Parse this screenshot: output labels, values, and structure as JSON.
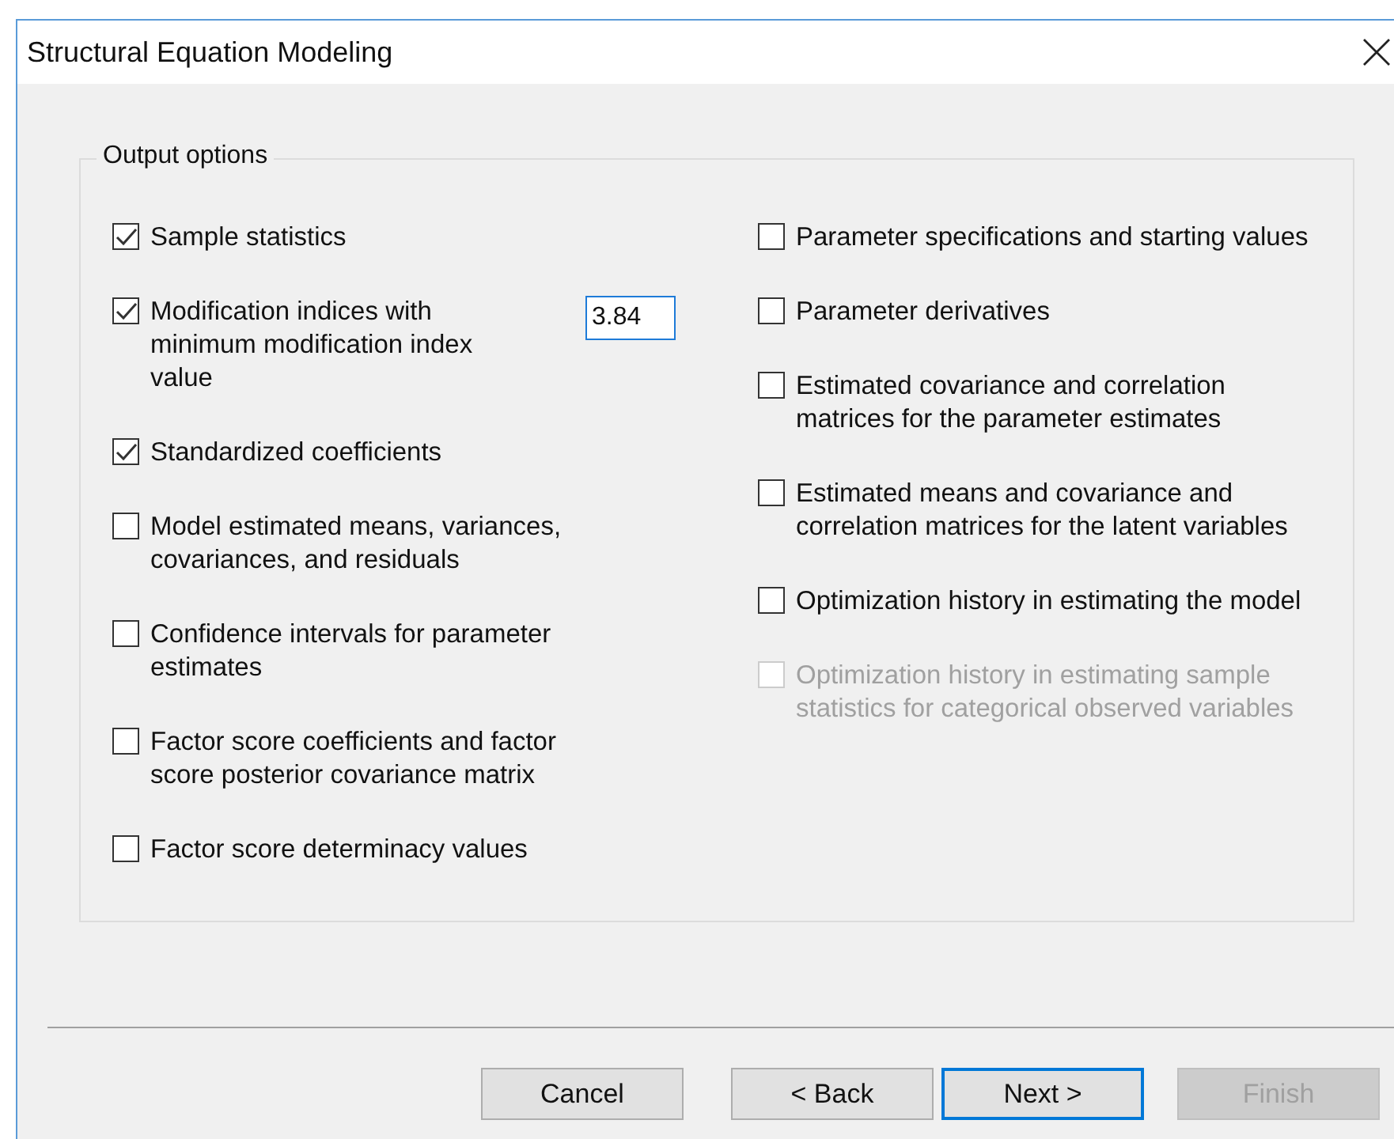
{
  "window": {
    "title": "Structural Equation Modeling"
  },
  "group": {
    "title": "Output options",
    "left": [
      {
        "label": "Sample statistics",
        "checked": true,
        "disabled": false
      },
      {
        "label": "Modification indices with minimum modification index value",
        "checked": true,
        "disabled": false,
        "value": "3.84"
      },
      {
        "label": "Standardized coefficients",
        "checked": true,
        "disabled": false
      },
      {
        "label": "Model estimated means, variances, covariances, and residuals",
        "checked": false,
        "disabled": false
      },
      {
        "label": "Confidence intervals for parameter estimates",
        "checked": false,
        "disabled": false
      },
      {
        "label": "Factor score coefficients and factor score posterior covariance matrix",
        "checked": false,
        "disabled": false
      },
      {
        "label": "Factor score determinacy values",
        "checked": false,
        "disabled": false
      }
    ],
    "right": [
      {
        "label": "Parameter specifications and starting values",
        "checked": false,
        "disabled": false
      },
      {
        "label": "Parameter derivatives",
        "checked": false,
        "disabled": false
      },
      {
        "label": "Estimated covariance and correlation matrices for the parameter estimates",
        "checked": false,
        "disabled": false
      },
      {
        "label": "Estimated means and covariance and correlation matrices for the latent variables",
        "checked": false,
        "disabled": false
      },
      {
        "label": "Optimization history in estimating the model",
        "checked": false,
        "disabled": false
      },
      {
        "label": "Optimization history in estimating sample statistics for categorical observed variables",
        "checked": false,
        "disabled": true
      }
    ]
  },
  "buttons": [
    {
      "label": "Cancel",
      "default": false,
      "disabled": false
    },
    {
      "label": "< Back",
      "default": false,
      "disabled": false
    },
    {
      "label": "Next >",
      "default": true,
      "disabled": false
    },
    {
      "label": "Finish",
      "default": false,
      "disabled": true
    }
  ]
}
